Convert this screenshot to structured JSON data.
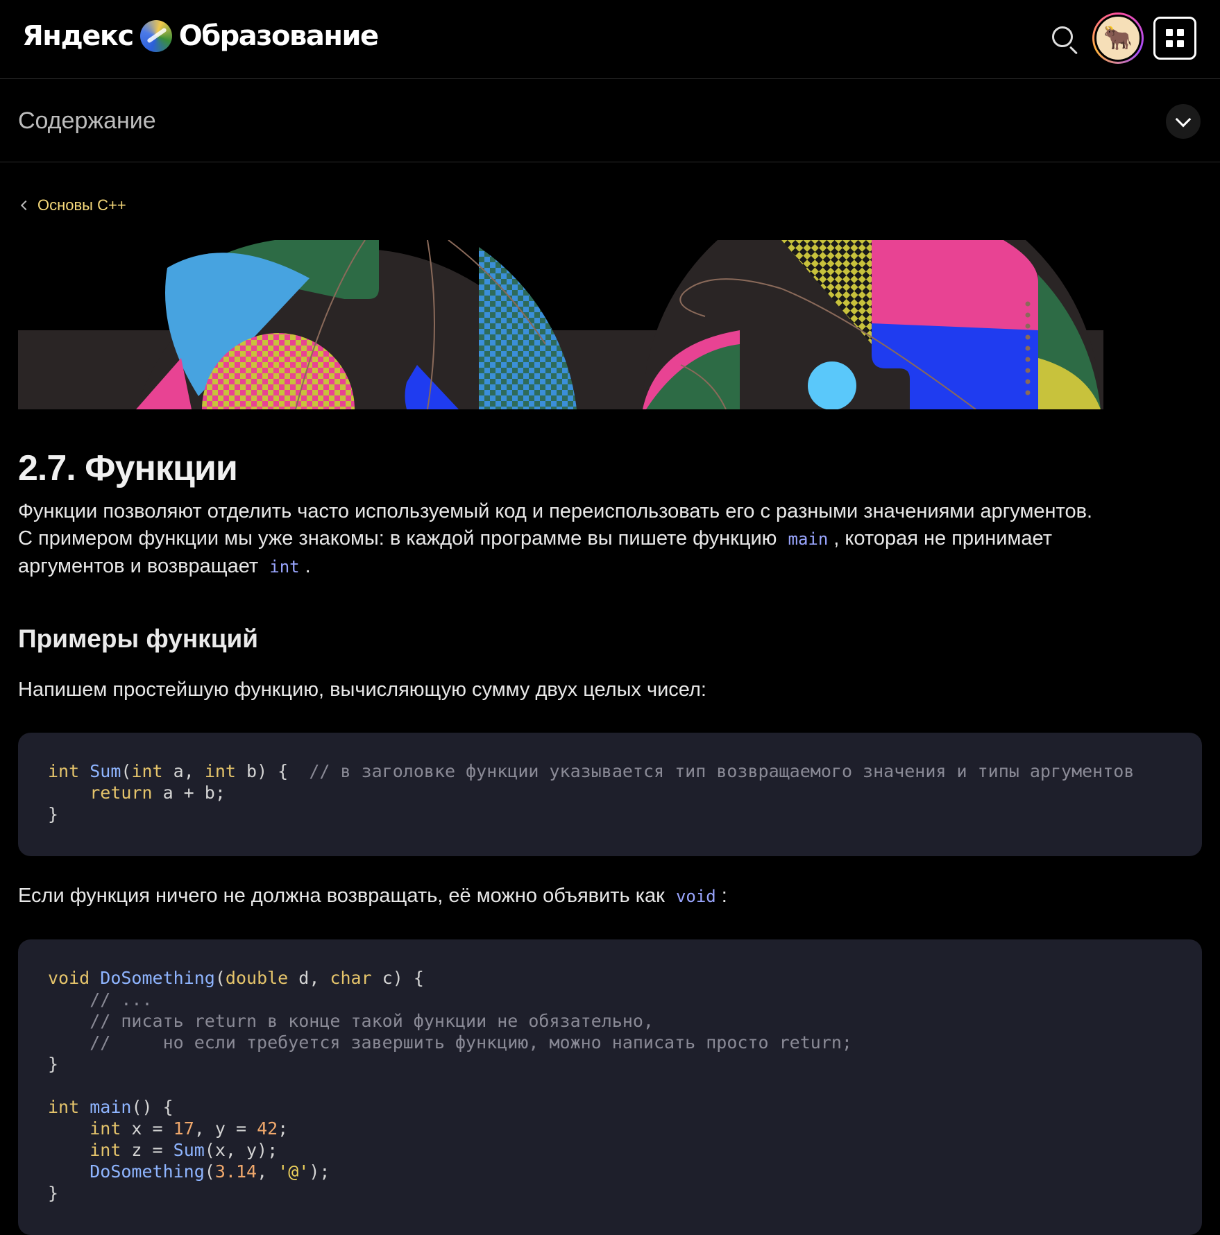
{
  "header": {
    "logo_left": "Яндекс",
    "logo_right": "Образование"
  },
  "toc": {
    "title": "Содержание"
  },
  "breadcrumb": {
    "label": "Основы C++"
  },
  "article": {
    "title": "2.7. Функции",
    "intro_line1": "Функции позволяют отделить часто используемый код и переиспользовать его с разными значениями аргументов.",
    "intro_line2_a": "С примером функции мы уже знакомы: в каждой программе вы пишете функцию",
    "intro_code_main": "main",
    "intro_line2_b": ", которая не принимает",
    "intro_line3_a": "аргументов и возвращает",
    "intro_code_int": "int",
    "intro_line3_b": ".",
    "section_title": "Примеры функций",
    "p_sum": "Напишем простейшую функцию, вычисляющую сумму двух целых чисел:",
    "p_void_a": "Если функция ничего не должна возвращать, её можно объявить как",
    "p_void_code": "void",
    "p_void_b": ":"
  },
  "code1": {
    "l1_kw1": "int",
    "l1_fn": "Sum",
    "l1_rest_a": "(",
    "l1_kw2": "int",
    "l1_a": " a, ",
    "l1_kw3": "int",
    "l1_b": " b) {  ",
    "l1_comment": "// в заголовке функции указывается тип возвращаемого значения и типы аргументов",
    "l2_indent": "    ",
    "l2_kw": "return",
    "l2_rest": " a + b;",
    "l3": "}"
  },
  "code2": {
    "l1_kw": "void",
    "l1_fn": "DoSomething",
    "l1_p1": "(",
    "l1_t1": "double",
    "l1_p2": " d, ",
    "l1_t2": "char",
    "l1_p3": " c) {",
    "l2": "    // ...",
    "l3": "    // писать return в конце такой функции не обязательно,",
    "l4": "    //     но если требуется завершить функцию, можно написать просто return;",
    "l5": "}",
    "l7_kw": "int",
    "l7_fn": "main",
    "l7_rest": "() {",
    "l8_kw": "int",
    "l8_a": " x = ",
    "l8_n1": "17",
    "l8_b": ", y = ",
    "l8_n2": "42",
    "l8_c": ";",
    "l9_kw": "int",
    "l9_a": " z = ",
    "l9_fn": "Sum",
    "l9_b": "(x, y);",
    "l10_fn": "DoSomething",
    "l10_a": "(",
    "l10_n": "3.14",
    "l10_b": ", ",
    "l10_s": "'@'",
    "l10_c": ");",
    "l11": "}"
  },
  "colors": {
    "background": "#000000",
    "code_bg": "#1e1f2b",
    "link_yellow": "#f5d87a",
    "code_keyword": "#e5c46b",
    "code_function": "#8fb5ff",
    "code_comment": "#8a8a96",
    "inline_code": "#9aa6ff"
  },
  "icons": [
    "logo-emblem-icon",
    "search-icon",
    "avatar",
    "apps-grid-icon",
    "chevron-down-icon",
    "chevron-left-icon"
  ]
}
